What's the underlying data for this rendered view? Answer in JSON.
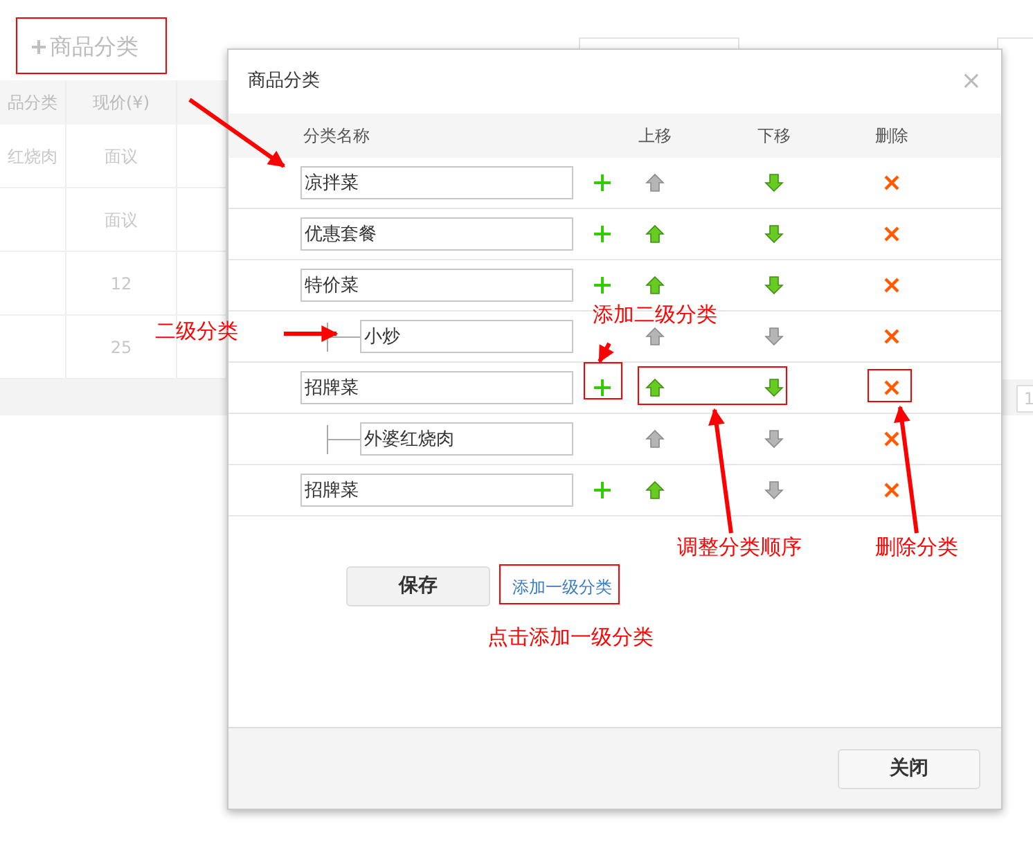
{
  "page": {
    "add_button": "商品分类",
    "columns": [
      "品分类",
      "现价(¥)"
    ],
    "rows": [
      [
        "红烧肉",
        "面议"
      ],
      [
        "",
        "面议"
      ],
      [
        "",
        "12"
      ],
      [
        "",
        "25"
      ]
    ],
    "pager": "1"
  },
  "dialog": {
    "title": "商品分类",
    "close": "×",
    "columns": [
      "分类名称",
      "上移",
      "下移",
      "删除"
    ],
    "categories": [
      {
        "name": "凉拌菜",
        "can_move_up": false,
        "can_move_down": true
      },
      {
        "name": "优惠套餐",
        "can_move_up": true,
        "can_move_down": true
      },
      {
        "name": "特价菜",
        "can_move_up": true,
        "can_move_down": true,
        "children": [
          {
            "name": "小炒",
            "can_move_up": false,
            "can_move_down": false
          }
        ]
      },
      {
        "name": "招牌菜",
        "can_move_up": true,
        "can_move_down": true,
        "children": [
          {
            "name": "外婆红烧肉",
            "can_move_up": false,
            "can_move_down": false
          }
        ]
      },
      {
        "name": "招牌菜",
        "can_move_up": true,
        "can_move_down": false
      }
    ],
    "save_button": "保存",
    "add_link": "添加一级分类",
    "close_button": "关闭"
  },
  "annotations": [
    "二级分类",
    "添加二级分类",
    "调整分类顺序",
    "删除分类",
    "点击添加一级分类"
  ]
}
